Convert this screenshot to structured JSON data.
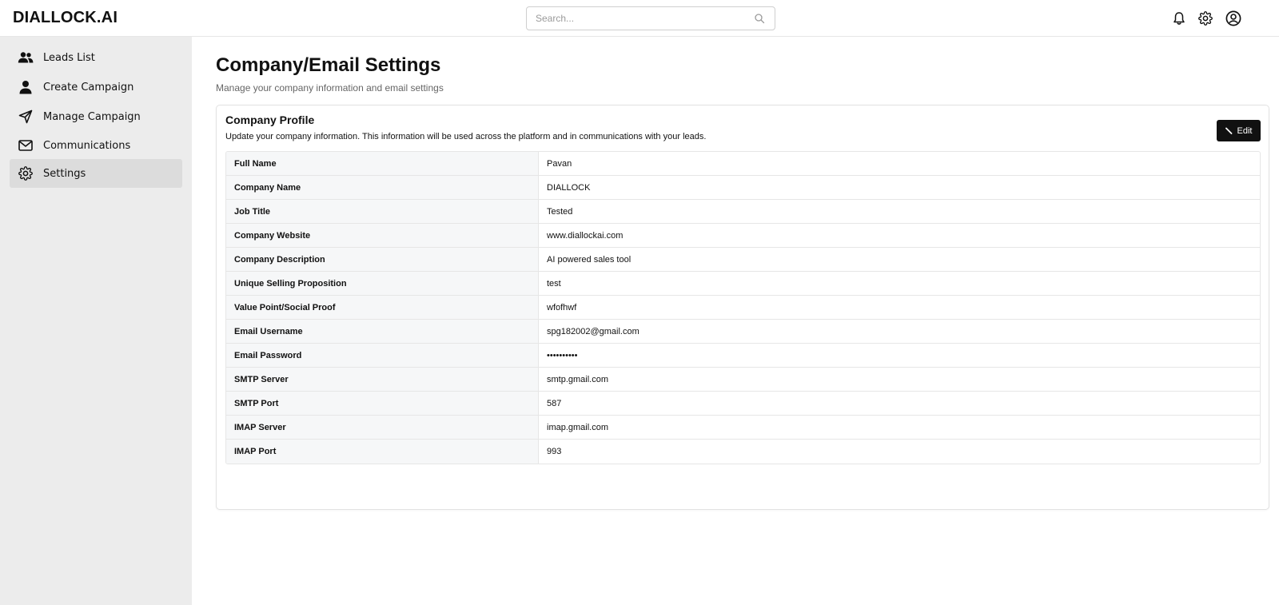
{
  "header": {
    "logo": "DIALLOCK.AI",
    "search_placeholder": "Search..."
  },
  "icons": {
    "search": "search-icon",
    "notifications": "bell-icon",
    "settings": "gear-icon",
    "profile": "user-circle-icon",
    "edit": "pen-icon"
  },
  "sidebar": {
    "items": [
      {
        "label": "Leads List",
        "icon": "users-icon",
        "active": false
      },
      {
        "label": "Create Campaign",
        "icon": "user-icon",
        "active": false
      },
      {
        "label": "Manage Campaign",
        "icon": "send-icon",
        "active": false
      },
      {
        "label": "Communications",
        "icon": "mail-icon",
        "active": false
      },
      {
        "label": "Settings",
        "icon": "gear-icon",
        "active": true
      }
    ]
  },
  "main": {
    "title": "Company/Email Settings",
    "subtitle": "Manage your company information and email settings"
  },
  "card": {
    "title": "Company Profile",
    "description": "Update your company information. This information will be used across the platform and in communications with your leads.",
    "edit_label": "Edit",
    "rows": [
      {
        "label": "Full Name",
        "value": "Pavan"
      },
      {
        "label": "Company Name",
        "value": "DIALLOCK"
      },
      {
        "label": "Job Title",
        "value": "Tested"
      },
      {
        "label": "Company Website",
        "value": "www.diallockai.com"
      },
      {
        "label": "Company Description",
        "value": "AI powered sales tool"
      },
      {
        "label": "Unique Selling Proposition",
        "value": "test"
      },
      {
        "label": "Value Point/Social Proof",
        "value": "wfofhwf"
      },
      {
        "label": "Email Username",
        "value": "spg182002@gmail.com"
      },
      {
        "label": "Email Password",
        "value": "••••••••••"
      },
      {
        "label": "SMTP Server",
        "value": "smtp.gmail.com"
      },
      {
        "label": "SMTP Port",
        "value": "587"
      },
      {
        "label": "IMAP Server",
        "value": "imap.gmail.com"
      },
      {
        "label": "IMAP Port",
        "value": "993"
      }
    ]
  },
  "colors": {
    "sidebar_bg": "#ececec",
    "active_item_bg": "#dcdcdc",
    "button_bg": "#111111",
    "label_cell_bg": "#f6f7f8",
    "border": "#e6e6e6"
  }
}
